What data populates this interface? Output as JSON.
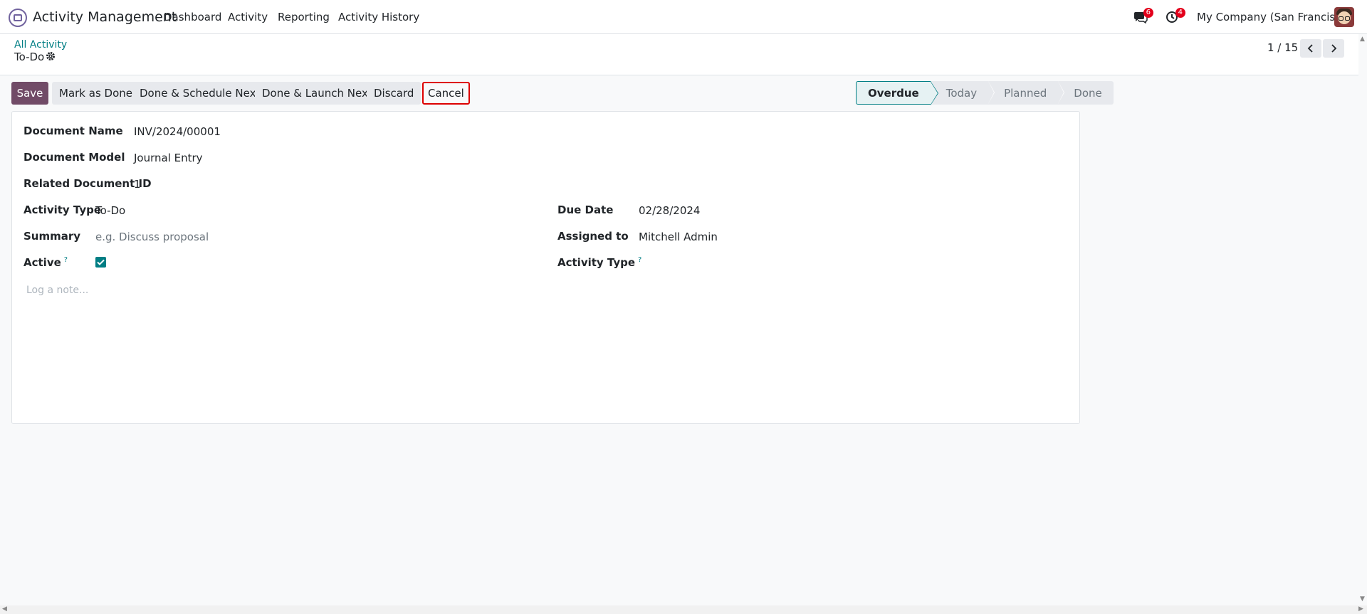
{
  "nav": {
    "app_name": "Activity Management",
    "menu": [
      "Dashboard",
      "Activity",
      "Reporting",
      "Activity History"
    ],
    "messages_count": "6",
    "activities_count": "4",
    "company": "My Company (San Francisco)"
  },
  "control": {
    "breadcrumb": "All Activity",
    "title": "To-Do",
    "pager": "1 / 15"
  },
  "buttons": {
    "save": "Save",
    "mark_done": "Mark as Done",
    "done_schedule": "Done & Schedule Next",
    "done_launch": "Done & Launch Next",
    "discard": "Discard",
    "cancel": "Cancel"
  },
  "statusbar": [
    "Overdue",
    "Today",
    "Planned",
    "Done"
  ],
  "form": {
    "document_name_label": "Document Name",
    "document_name": "INV/2024/00001",
    "document_model_label": "Document Model",
    "document_model": "Journal Entry",
    "related_id_label": "Related Document ID",
    "related_id": "1",
    "activity_type_label": "Activity Type",
    "activity_type": "To-Do",
    "summary_label": "Summary",
    "summary_placeholder": "e.g. Discuss proposal",
    "active_label": "Active",
    "help_mark": "?",
    "due_date_label": "Due Date",
    "due_date": "02/28/2024",
    "assigned_label": "Assigned to",
    "assigned_to": "Mitchell Admin",
    "activity_type2_label": "Activity Type",
    "log_note_placeholder": "Log a note..."
  },
  "colors": {
    "brand": "#714b67",
    "accent": "#017e84",
    "badge": "#e3001b"
  }
}
